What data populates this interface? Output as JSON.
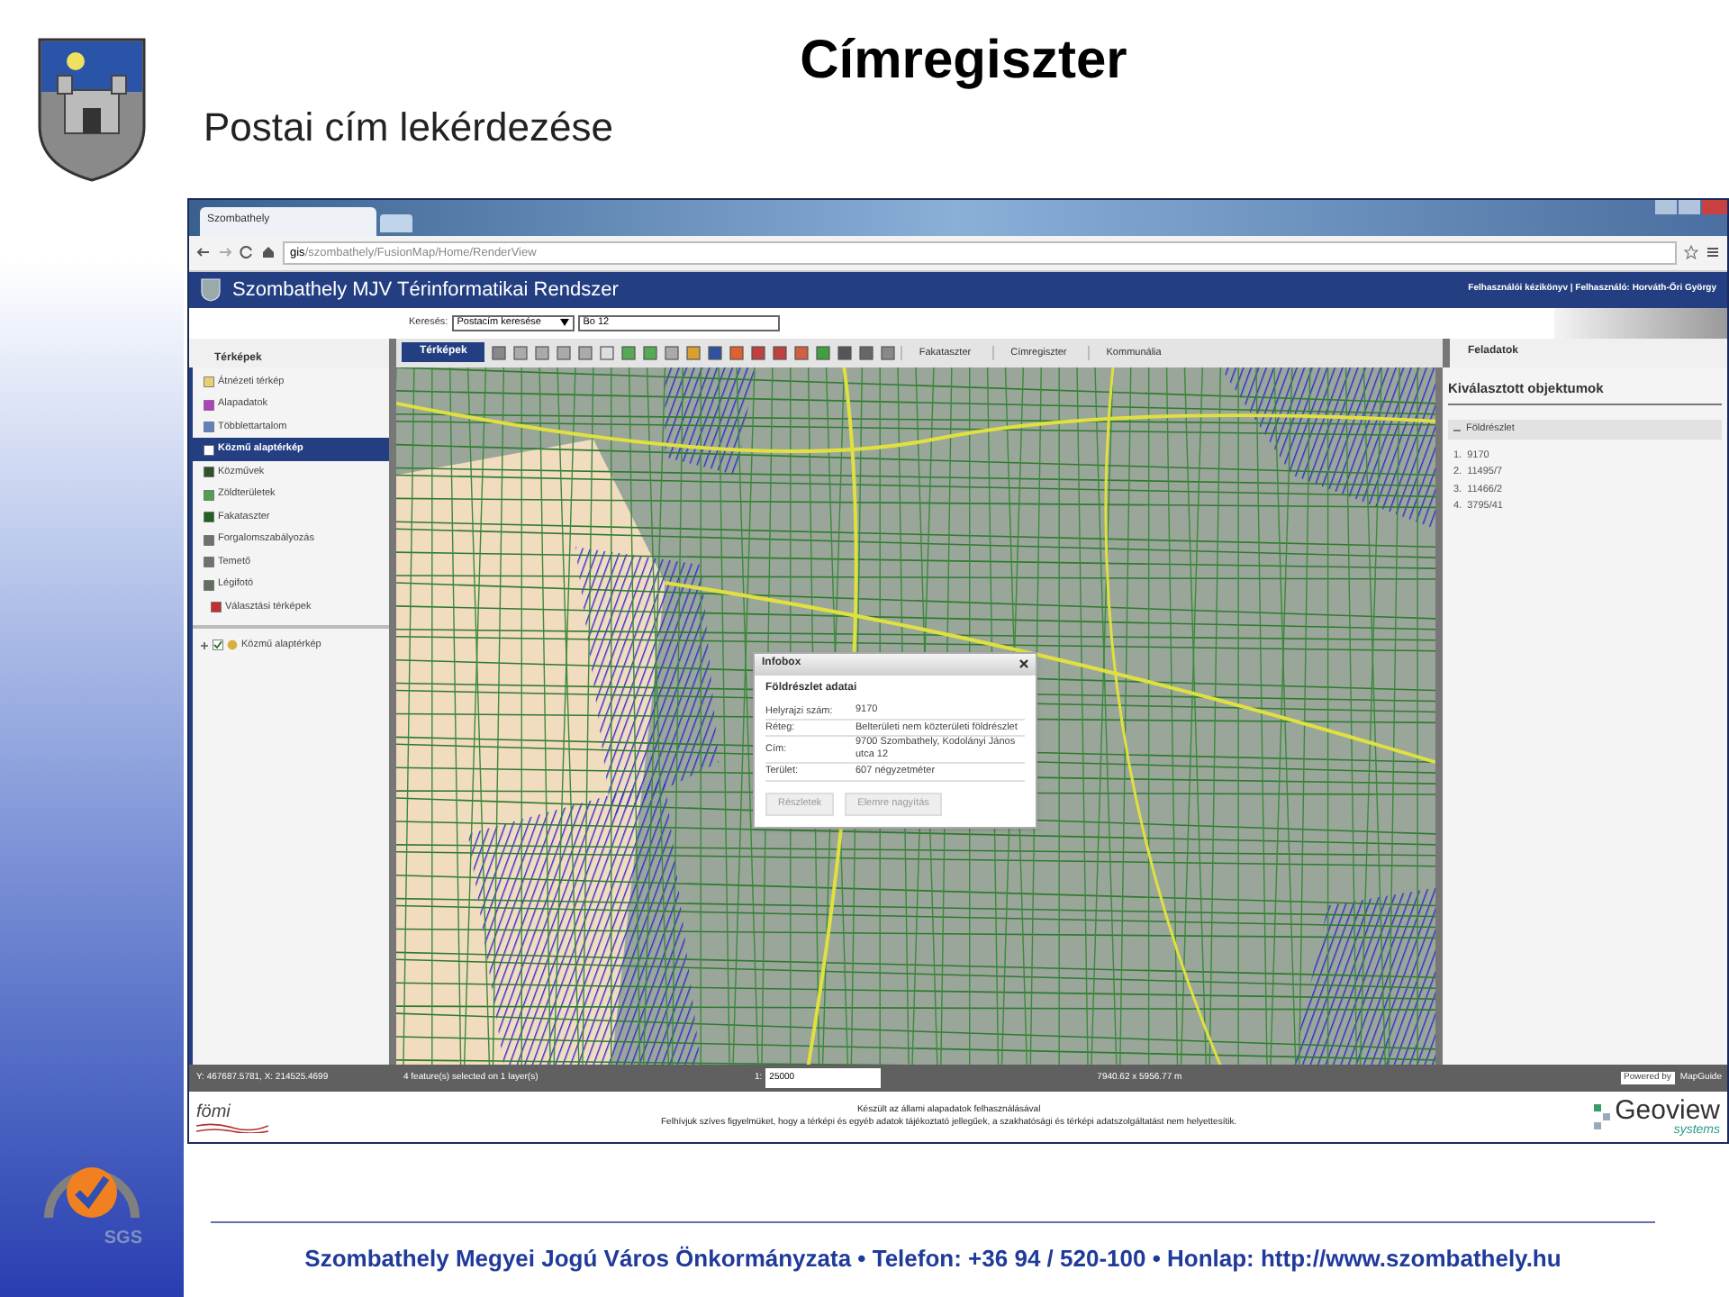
{
  "slide": {
    "title": "Címregiszter",
    "subtitle": "Postai cím lekérdezése"
  },
  "browser": {
    "tab_title": "Szombathely",
    "url_host": "gis",
    "url_path": "/szombathely/FusionMap/Home/RenderView"
  },
  "app": {
    "title": "Szombathely MJV Térinformatikai Rendszer",
    "user_links": "Felhasználói kézikönyv | Felhasználó: Horváth-Őri György"
  },
  "search": {
    "label": "Keresés:",
    "type_value": "Postacím keresése",
    "query": "Bo 12"
  },
  "toolbar": {
    "maps_tab": "Térképek",
    "buttons": [
      "Fakataszter",
      "Címregiszter",
      "Kommunália"
    ]
  },
  "sidebar": {
    "title": "Térképek",
    "items": [
      {
        "label": "Átnézeti térkép",
        "selected": false
      },
      {
        "label": "Alapadatok",
        "selected": false
      },
      {
        "label": "Többlettartalom",
        "selected": false
      },
      {
        "label": "Közmű alaptérkép",
        "selected": true
      },
      {
        "label": "Közművek",
        "selected": false
      },
      {
        "label": "Zöldterületek",
        "selected": false
      },
      {
        "label": "Fakataszter",
        "selected": false
      },
      {
        "label": "Forgalomszabályozás",
        "selected": false
      },
      {
        "label": "Temető",
        "selected": false
      },
      {
        "label": "Légifotó",
        "selected": false
      },
      {
        "label": "Választási térképek",
        "selected": false
      }
    ],
    "layer_tree": [
      {
        "label": "Közmű alaptérkép",
        "checked": true,
        "expanded": false
      }
    ]
  },
  "right_panel": {
    "tab": "Feladatok",
    "title": "Kiválasztott objektumok",
    "group": {
      "label": "Földrészlet",
      "expanded": true
    },
    "items": [
      {
        "number": "1.",
        "value": "9170"
      },
      {
        "number": "2.",
        "value": "11495/7"
      },
      {
        "number": "3.",
        "value": "11466/2"
      },
      {
        "number": "4.",
        "value": "3795/41"
      }
    ]
  },
  "infobox": {
    "title": "Infobox",
    "subtitle": "Földrészlet adatai",
    "rows": [
      {
        "label": "Helyrajzi szám:",
        "value": "9170"
      },
      {
        "label": "Réteg:",
        "value": "Belterületi nem közterületi földrészlet"
      },
      {
        "label": "Cím:",
        "value": "9700 Szombathely, Kodolányi János utca 12"
      },
      {
        "label": "Terület:",
        "value": "607 négyzetméter"
      }
    ],
    "buttons": [
      "Részletek",
      "Elemre nagyítás"
    ]
  },
  "status_bar": {
    "coordinates": "Y: 467687.5781, X: 214525.4699",
    "selection": "4 feature(s) selected on 1 layer(s)",
    "scale_label": "1:",
    "scale": "25000",
    "extent": "7940.62 x 5956.77 m",
    "powered_by": "Powered by",
    "powered_brand": "MapGuide"
  },
  "app_footer": {
    "logo_left": "fömi",
    "line1": "Készült az állami alapadatok felhasználásával",
    "line2": "Felhívjuk szíves figyelmüket, hogy a térképi és egyéb adatok tájékoztató jellegűek, a szakhatósági és térképi adatszolgáltatást nem helyettesítik.",
    "logo_right": "Geoview",
    "logo_right_sub": "systems"
  },
  "badge": {
    "text": "SGS"
  },
  "footer": {
    "text": "Szombathely Megyei Jogú Város Önkormányzata • Telefon: +36 94 / 520-100 • Honlap: http://www.szombathely.hu"
  }
}
